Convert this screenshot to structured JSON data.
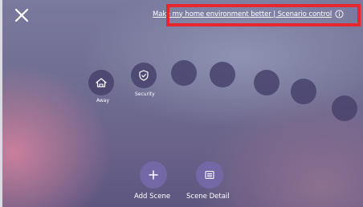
{
  "header": {
    "link_text": "Make my home environment better | Scenario control"
  },
  "scenes": [
    {
      "label": "Away",
      "icon": "away-home-icon"
    },
    {
      "label": "Security",
      "icon": "shield-icon"
    },
    {
      "label": "",
      "icon": ""
    },
    {
      "label": "",
      "icon": ""
    },
    {
      "label": "",
      "icon": ""
    },
    {
      "label": "",
      "icon": ""
    },
    {
      "label": "",
      "icon": ""
    }
  ],
  "actions": {
    "add_scene_label": "Add Scene",
    "scene_detail_label": "Scene Detail"
  },
  "colors": {
    "highlight": "#e8262e",
    "scene_circle": "#48426c",
    "action_circle": "#7668aa"
  }
}
